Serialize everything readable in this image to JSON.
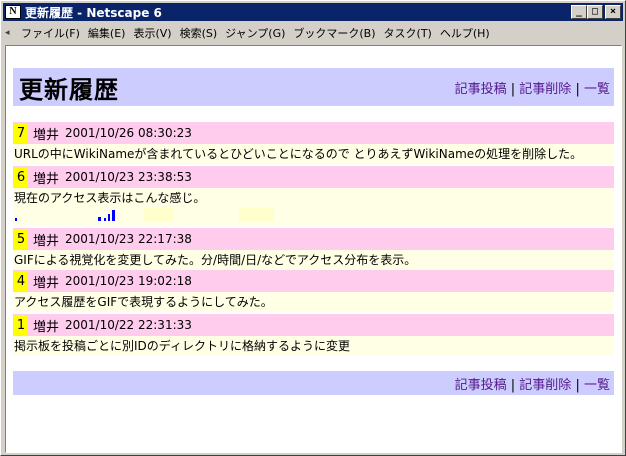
{
  "window": {
    "title": "更新履歴 - Netscape 6",
    "icon_letter": "N",
    "minimize": "_",
    "maximize": "□",
    "close": "×"
  },
  "menu": [
    "ファイル(F)",
    "編集(E)",
    "表示(V)",
    "検索(S)",
    "ジャンプ(G)",
    "ブックマーク(B)",
    "タスク(T)",
    "ヘルプ(H)"
  ],
  "page": {
    "title": "更新履歴",
    "nav": {
      "post": "記事投稿",
      "delete": "記事削除",
      "list": "一覧",
      "sep": "|"
    }
  },
  "entries": [
    {
      "num": "7",
      "author": "増井",
      "date": "2001/10/26 08:30:23",
      "body": "URLの中にWikiNameが含まれているとひどいことになるので とりあえずWikiNameの処理を削除した。"
    },
    {
      "num": "6",
      "author": "増井",
      "date": "2001/10/23 23:38:53",
      "body": "現在のアクセス表示はこんな感じ。"
    },
    {
      "num": "5",
      "author": "増井",
      "date": "2001/10/23 22:17:38",
      "body": "GIFによる視覚化を変更してみた。分/時間/日/などでアクセス分布を表示。"
    },
    {
      "num": "4",
      "author": "増井",
      "date": "2001/10/23 19:02:18",
      "body": "アクセス履歴をGIFで表現するようにしてみた。"
    },
    {
      "num": "1",
      "author": "増井",
      "date": "2001/10/22 22:31:33",
      "body": "掲示板を投稿ごとに別IDのディレクトリに格納するように変更"
    }
  ],
  "colors": {
    "header_bg": "#ccccff",
    "entry_head_bg": "#ffccee",
    "entry_body_bg": "#ffffe5",
    "num_bg": "#ffff00",
    "link": "#551a8b",
    "chart_bar": "#0000ff"
  }
}
